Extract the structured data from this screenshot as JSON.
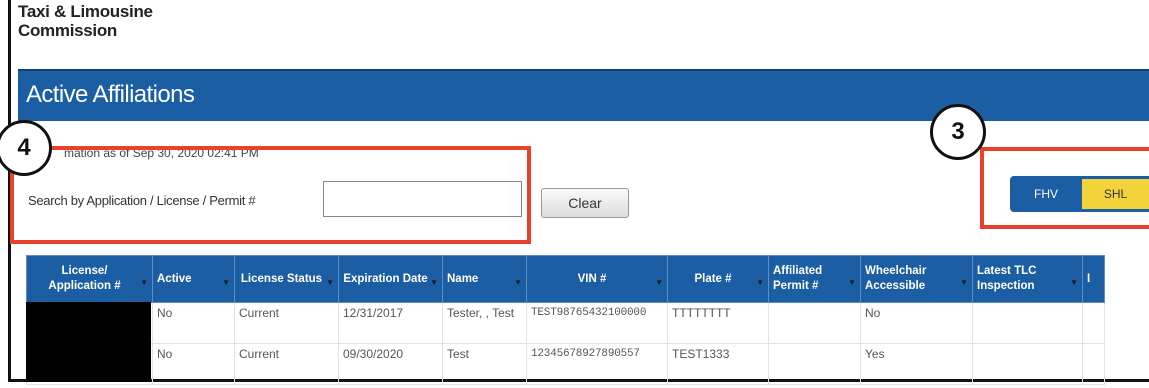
{
  "org": {
    "line1": "Taxi & Limousine",
    "line2": "Commission"
  },
  "header": {
    "title": "Active Affiliations"
  },
  "info_text": "mation as of  Sep 30, 2020 02:41 PM",
  "search": {
    "label": "Search by Application / License / Permit #",
    "value": "",
    "clear_label": "Clear"
  },
  "toggle": {
    "options": [
      "FHV",
      "SHL"
    ],
    "selected": "SHL"
  },
  "callouts": [
    "4",
    "3"
  ],
  "table": {
    "columns": [
      "License/ Application #",
      "Active",
      "License Status",
      "Expiration Date",
      "Name",
      "VIN #",
      "Plate #",
      "Affiliated Permit #",
      "Wheelchair Accessible",
      "Latest TLC Inspection",
      "I"
    ],
    "rows": [
      [
        "",
        "No",
        "Current",
        "12/31/2017",
        "Tester, , Test",
        "TEST98765432100000",
        "TTTTTTTT",
        "",
        "No",
        "",
        ""
      ],
      [
        "",
        "No",
        "Current",
        "09/30/2020",
        "Test",
        "12345678927890557",
        "TEST1333",
        "",
        "Yes",
        "",
        ""
      ]
    ]
  },
  "colors": {
    "header_blue": "#1b5ea3",
    "highlight_red": "#e8432a",
    "toggle_selected": "#f2d33a"
  }
}
